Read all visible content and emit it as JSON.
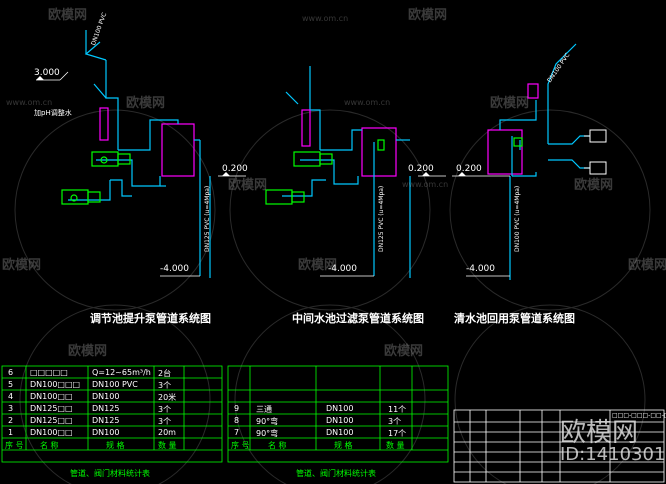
{
  "diagram_titles": [
    "调节池提升泵管道系统图",
    "中间水池过滤泵管道系统图",
    "清水池回用泵管道系统图"
  ],
  "elevations": {
    "left_top": "3.000",
    "left_mid": "0.200",
    "left_bottom": "-4.000",
    "mid_mid": "0.200",
    "mid_bottom": "-4.000",
    "right_mid": "0.200",
    "right_bottom": "-4.000"
  },
  "pipe_labels": {
    "left_vertical_top": "DN100 PVC",
    "right_vertical_top": "DN100 PVC",
    "left_riser": "DN125 PVC (u=4Mpa)",
    "mid_riser": "DN125 PVC (u=4Mpa)",
    "right_riser": "DN100 PVC (u=4Mpa)",
    "left_ph": "加pH调整水"
  },
  "table_left": {
    "rows": [
      {
        "no": "6",
        "name": "□□□□□",
        "spec": "Q=12~65m³/h",
        "qty": "2台"
      },
      {
        "no": "5",
        "name": "DN100□□□",
        "spec": "DN100 PVC",
        "qty": "3个"
      },
      {
        "no": "4",
        "name": "DN100□□",
        "spec": "DN100",
        "qty": "20米"
      },
      {
        "no": "3",
        "name": "DN125□□",
        "spec": "DN125",
        "qty": "3个"
      },
      {
        "no": "2",
        "name": "DN125□□",
        "spec": "DN125",
        "qty": "3个"
      },
      {
        "no": "1",
        "name": "DN100□□",
        "spec": "DN100",
        "qty": "20m"
      }
    ],
    "header": [
      "序 号",
      "名 称",
      "规 格",
      "数 量"
    ],
    "caption": "管道、阀门材料统计表"
  },
  "table_right": {
    "rows": [
      {
        "no": "9",
        "name": "三通",
        "spec": "DN100",
        "qty": "11个"
      },
      {
        "no": "8",
        "name": "90°弯",
        "spec": "DN100",
        "qty": "3个"
      },
      {
        "no": "7",
        "name": "90°弯",
        "spec": "DN100",
        "qty": "17个"
      }
    ],
    "header": [
      "序 号",
      "名 称",
      "规 格",
      "数 量"
    ],
    "caption": "管道、阀门材料统计表"
  },
  "title_block": {
    "drawing_no": "□□□-□□□-□□-□□"
  },
  "watermarks": {
    "brand": "欧模网",
    "url": "www.om.cn",
    "big_brand": "欧模网",
    "id_text": "ID:1410301"
  },
  "colors": {
    "background": "#000000",
    "pipe_blue": "#00c8ff",
    "pump_green": "#00ff00",
    "tank_magenta": "#ff00ff",
    "text_white": "#ffffff",
    "table_green": "#00ff00"
  }
}
